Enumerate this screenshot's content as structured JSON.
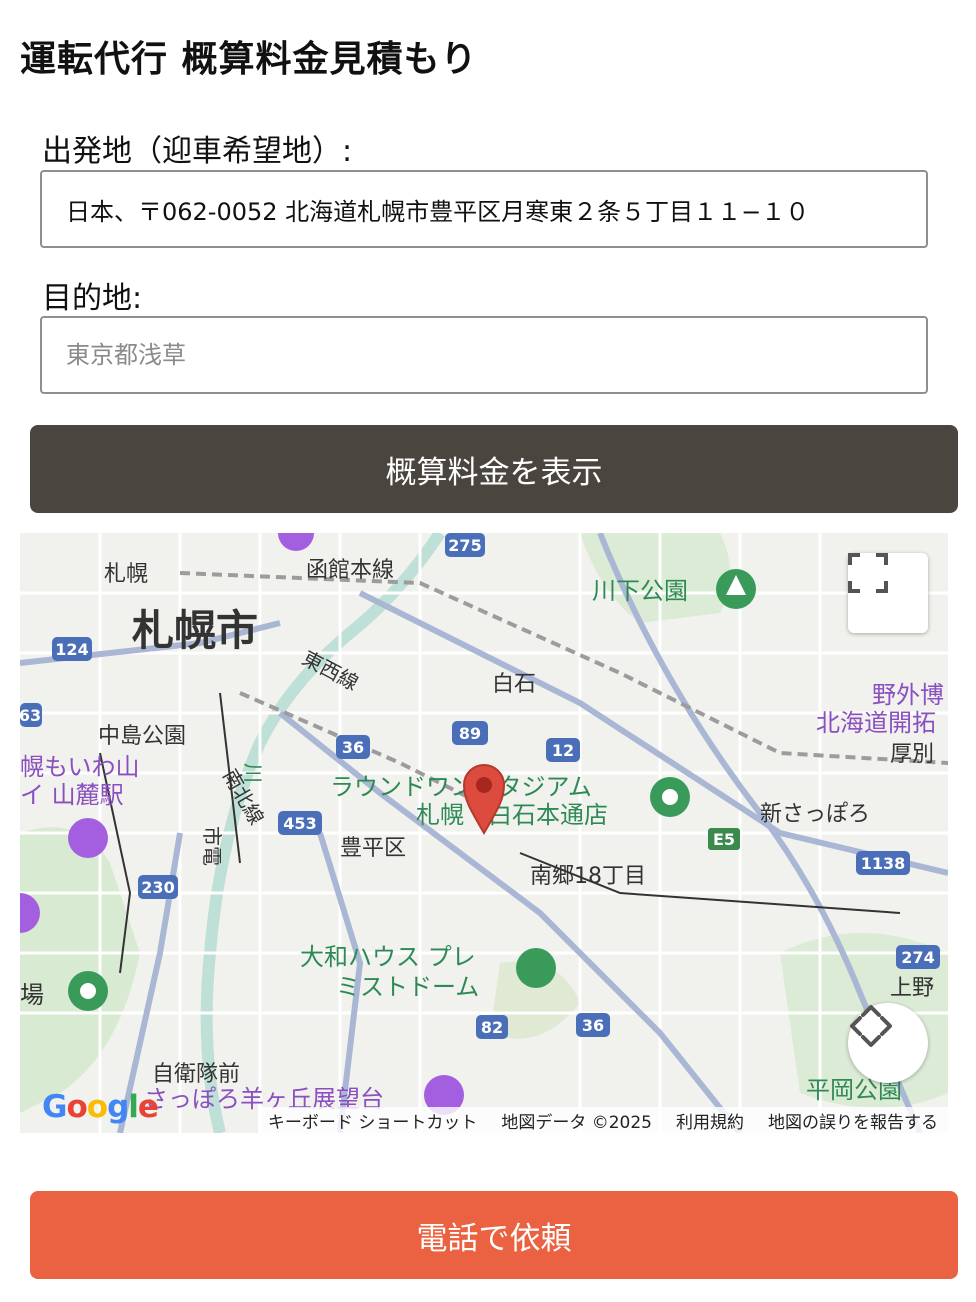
{
  "page": {
    "title": "運転代行 概算料金見積もり"
  },
  "form": {
    "origin_label": "出発地（迎車希望地）:",
    "origin_value": "日本、〒062-0052 北海道札幌市豊平区月寒東２条５丁目１１−１０",
    "destination_label": "目的地:",
    "destination_placeholder": "東京都浅草",
    "estimate_button": "概算料金を表示"
  },
  "map": {
    "labels": {
      "sapporo_city": "札幌市",
      "sapporo_station": "札幌",
      "hakodate_line": "函館本線",
      "tozai_line": "東西線",
      "shiroishi": "白石",
      "nakajima_park": "中島公園",
      "nanboku_line": "南北線",
      "shiden": "市電",
      "toyohira_ku": "豊平区",
      "moiwa": "幌もいわ山",
      "moiwa2": "イ 山麓駅",
      "round1_a": "ラウンドワンスタジアム",
      "round1_b": "札幌・白石本通店",
      "minamigo": "南郷18丁目",
      "shinsapporo": "新さっぽろ",
      "kawashimo_park": "川下公園",
      "museum_a": "野外博",
      "museum_b": "北海道開拓",
      "atsubetsu": "厚別",
      "daiwa_a": "大和ハウス プレ",
      "daiwa_b": "ミストドーム",
      "jieitai": "自衛隊前",
      "hitsujigaoka": "さっぽろ羊ヶ丘展望台",
      "heiwa_park": "平岡公園",
      "kamino": "上野",
      "ba": "場",
      "kawashimo_shi": "川"
    },
    "route_shields": [
      "275",
      "124",
      "89",
      "12",
      "36",
      "453",
      "230",
      "82",
      "1138",
      "274",
      "E5",
      "63"
    ],
    "attribution": {
      "shortcuts": "キーボード ショートカット",
      "map_data": "地図データ ©2025",
      "terms": "利用規約",
      "report": "地図の誤りを報告する"
    },
    "logo": "Google"
  },
  "cta": {
    "call_button": "電話で依頼"
  },
  "colors": {
    "estimate_button": "#4b4540",
    "call_button": "#ea6241",
    "marker": "#dd4b3e"
  }
}
